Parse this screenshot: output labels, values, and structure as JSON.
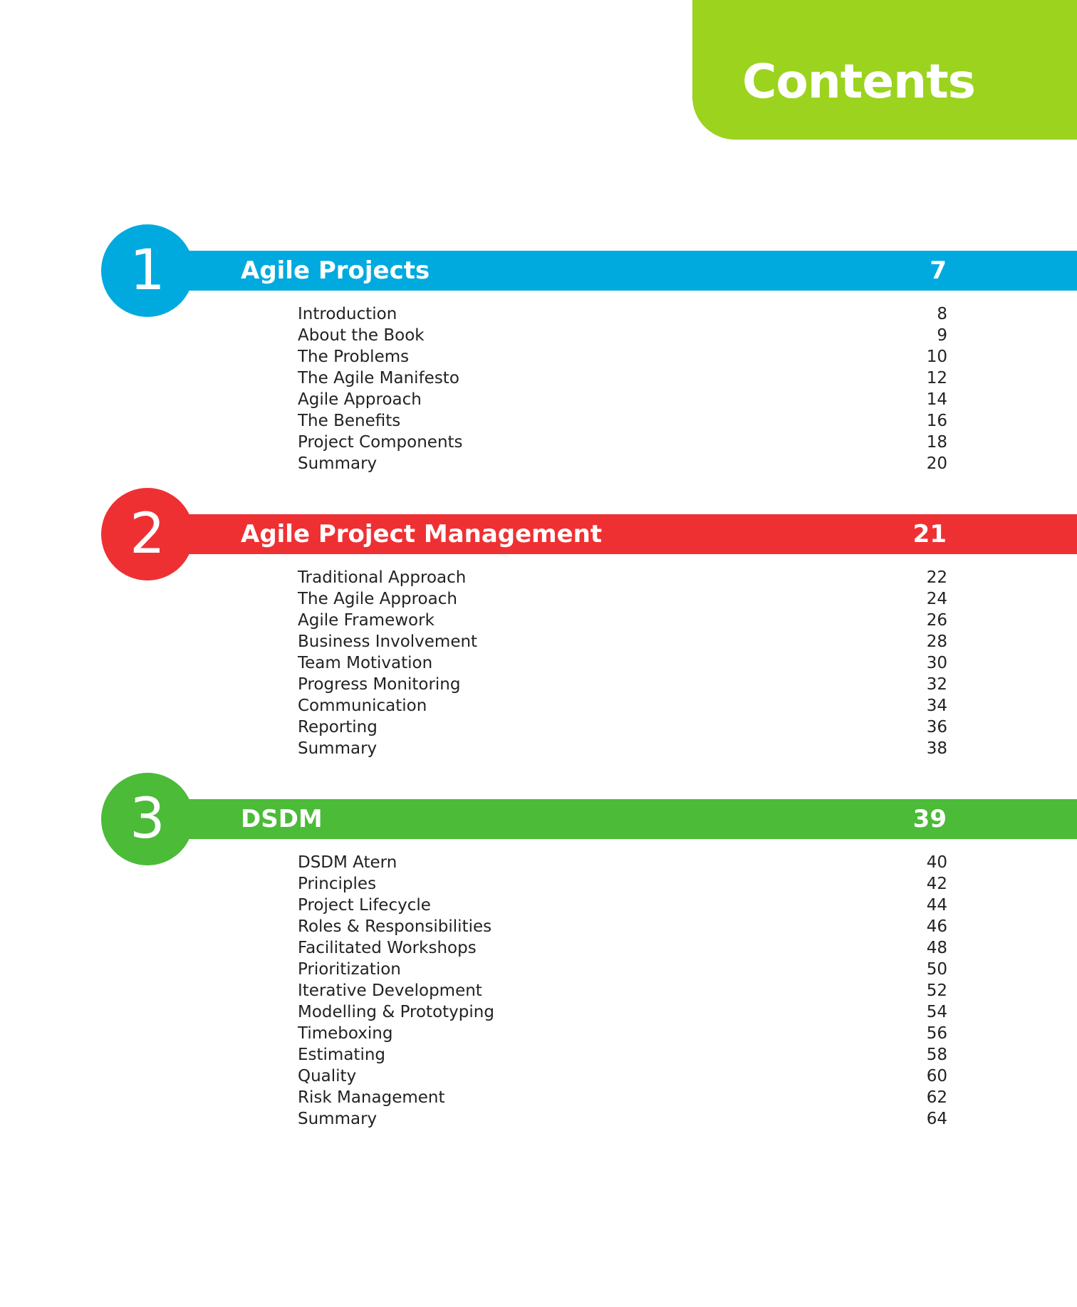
{
  "header": {
    "title": "Contents",
    "tab_color": "#9BD31E"
  },
  "chapters": [
    {
      "number": "1",
      "title": "Agile Projects",
      "page": "7",
      "color": "#00AADE",
      "entries": [
        {
          "label": "Introduction",
          "page": "8"
        },
        {
          "label": "About the Book",
          "page": "9"
        },
        {
          "label": "The Problems",
          "page": "10"
        },
        {
          "label": "The Agile Manifesto",
          "page": "12"
        },
        {
          "label": "Agile Approach",
          "page": "14"
        },
        {
          "label": "The Benefits",
          "page": "16"
        },
        {
          "label": "Project Components",
          "page": "18"
        },
        {
          "label": "Summary",
          "page": "20"
        }
      ]
    },
    {
      "number": "2",
      "title": "Agile Project Management",
      "page": "21",
      "color": "#EF3033",
      "entries": [
        {
          "label": "Traditional Approach",
          "page": "22"
        },
        {
          "label": "The Agile Approach",
          "page": "24"
        },
        {
          "label": "Agile Framework",
          "page": "26"
        },
        {
          "label": "Business Involvement",
          "page": "28"
        },
        {
          "label": "Team Motivation",
          "page": "30"
        },
        {
          "label": "Progress Monitoring",
          "page": "32"
        },
        {
          "label": "Communication",
          "page": "34"
        },
        {
          "label": "Reporting",
          "page": "36"
        },
        {
          "label": "Summary",
          "page": "38"
        }
      ]
    },
    {
      "number": "3",
      "title": "DSDM",
      "page": "39",
      "color": "#4BBB38",
      "entries": [
        {
          "label": "DSDM Atern",
          "page": "40"
        },
        {
          "label": "Principles",
          "page": "42"
        },
        {
          "label": "Project Lifecycle",
          "page": "44"
        },
        {
          "label": "Roles & Responsibilities",
          "page": "46"
        },
        {
          "label": "Facilitated Workshops",
          "page": "48"
        },
        {
          "label": "Prioritization",
          "page": "50"
        },
        {
          "label": "Iterative Development",
          "page": "52"
        },
        {
          "label": "Modelling & Prototyping",
          "page": "54"
        },
        {
          "label": "Timeboxing",
          "page": "56"
        },
        {
          "label": "Estimating",
          "page": "58"
        },
        {
          "label": "Quality",
          "page": "60"
        },
        {
          "label": "Risk Management",
          "page": "62"
        },
        {
          "label": "Summary",
          "page": "64"
        }
      ]
    }
  ]
}
